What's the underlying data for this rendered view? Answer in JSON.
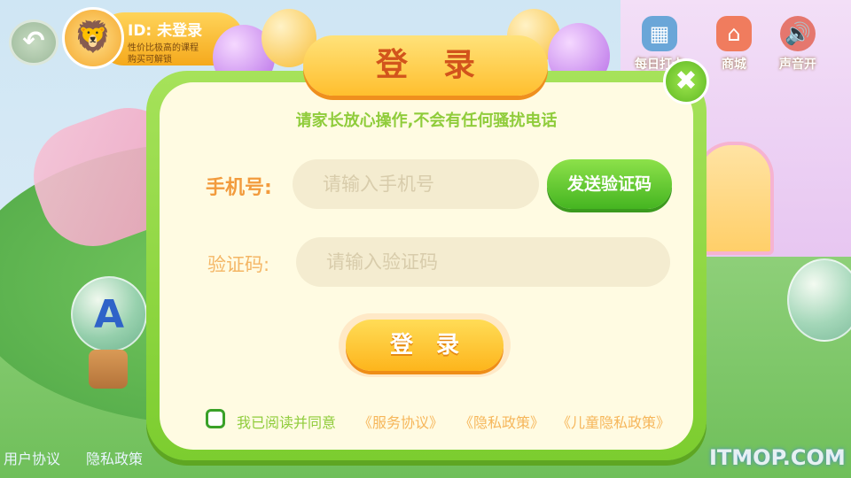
{
  "profile": {
    "id_text": "ID: 未登录",
    "sub_line1": "性价比极高的课程",
    "sub_line2": "购买可解锁"
  },
  "top_icons": [
    {
      "name": "daily",
      "label": "每日打卡",
      "icon": "calendar-icon"
    },
    {
      "name": "shop",
      "label": "商城",
      "icon": "shop-icon"
    },
    {
      "name": "sound",
      "label": "声音开",
      "icon": "speaker-icon"
    }
  ],
  "bottom_links": [
    "用户协议",
    "隐私政策"
  ],
  "scene": {
    "bubble_letter": "A"
  },
  "dialog": {
    "title": "登录",
    "subtitle": "请家长放心操作,不会有任何骚扰电话",
    "phone_label": "手机号:",
    "phone_placeholder": "请输入手机号",
    "send_code": "发送验证码",
    "code_label": "验证码:",
    "code_placeholder": "请输入验证码",
    "login_button": "登录",
    "agree_text": "我已阅读并同意",
    "policies": [
      "《服务协议》",
      "《隐私政策》",
      "《儿童隐私政策》"
    ],
    "close_symbol": "✖"
  },
  "watermark": "ITMOP.COM",
  "colors": {
    "accent_green": "#7ccd2f",
    "accent_orange": "#ffbf2e",
    "label_orange": "#f29b3d",
    "dialog_bg": "#fffbe2"
  }
}
